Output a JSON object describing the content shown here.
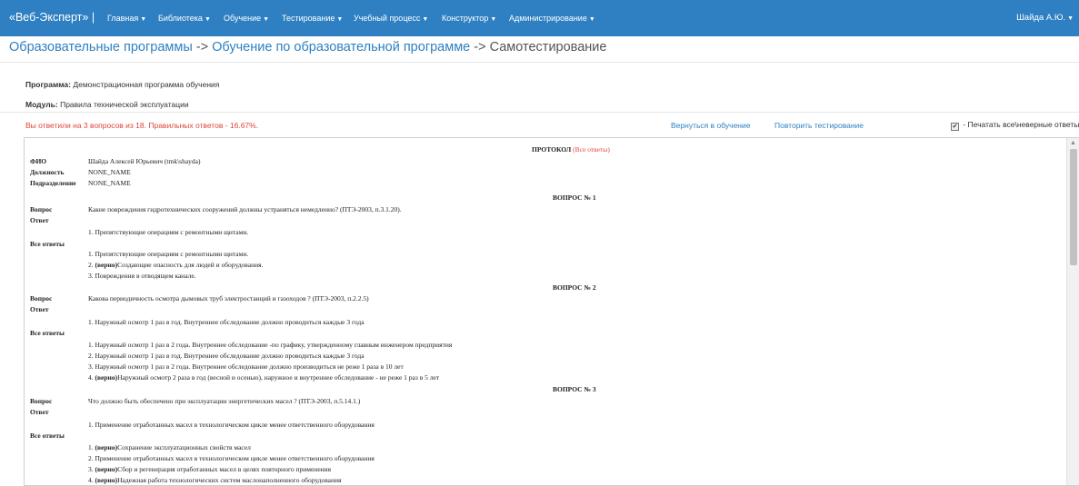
{
  "navbar": {
    "brand": "«Веб-Эксперт» |",
    "menu": [
      "Главная",
      "Библиотека",
      "Обучение",
      "Тестирование",
      "Учебный процесс",
      "Конструктор",
      "Администрирование"
    ],
    "user": "Шайда А.Ю.",
    "colors": {
      "background": "#2f80c2",
      "text": "#ffffff"
    }
  },
  "breadcrumb": {
    "part1": "Образовательные программы",
    "sep1": " -> ",
    "part2": "Обучение по образовательной программе",
    "sep2": " -> ",
    "part3": "Самотестирование"
  },
  "program": {
    "label": "Программа:",
    "value": " Демонстрационная программа обучения"
  },
  "module": {
    "label": "Модуль:",
    "value": " Правила технической эксплуатации"
  },
  "result_text": "Вы ответили на 3 вопросов из 18. Правильных ответов - 16.67%.",
  "actions": {
    "back": "Вернуться в обучение",
    "retry": "Повторить тестирование"
  },
  "print_option": {
    "checked": true,
    "label": " - Печатать все\\неверные ответы"
  },
  "protocol": {
    "title": "ПРОТОКОЛ",
    "all_answers_link": "(Все ответы)",
    "fio_label": "ФИО",
    "fio_value": "Шайда Алексей Юрьевич (tmk\\shayda)",
    "position_label": "Должность",
    "position_value": "NONE_NAME",
    "department_label": "Подразделение",
    "department_value": "NONE_NAME",
    "question_label": "Вопрос",
    "answer_label": "Ответ",
    "all_label": "Все ответы",
    "correct_mark": "(верно)",
    "questions": [
      {
        "header": "ВОПРОС № 1",
        "text": "Какие повреждения гидротехнических сооружений должны устраняться немедленно? (ПТЭ-2003, п.3.1.20).",
        "answer": "1. Препятствующие операциям с ремонтными щитами.",
        "options": [
          {
            "prefix": "1. ",
            "correct": false,
            "text": "Препятствующие операциям с ремонтными щитами."
          },
          {
            "prefix": "2. ",
            "correct": true,
            "text": "Создающие опасность для людей и оборудования."
          },
          {
            "prefix": "3. ",
            "correct": false,
            "text": "Повреждения в отводящем канале."
          }
        ]
      },
      {
        "header": "ВОПРОС № 2",
        "text": "Какова периодичность осмотра дымовых труб электростанций и газоходов ? (ПТЭ-2003, п.2.2.5)",
        "answer": "1. Наружный осмотр 1 раз в год. Внутреннее обследование должно проводиться каждые 3 года",
        "options": [
          {
            "prefix": "1. ",
            "correct": false,
            "text": "Наружный осмотр 1 раз в 2 года. Внутреннее обследование -по графику, утвержденному главным инженером предприятия"
          },
          {
            "prefix": "2. ",
            "correct": false,
            "text": "Наружный осмотр 1 раз в год. Внутреннее обследование должно проводиться каждые 3 года"
          },
          {
            "prefix": "3. ",
            "correct": false,
            "text": "Наружный осмотр 1 раз в 2 года. Внутреннее обследование должно производиться не реже 1 раза в 10 лет"
          },
          {
            "prefix": "4. ",
            "correct": true,
            "text": "Наружный осмотр 2 раза в год (весной и осенью), наружное и внутреннее обследование - не реже 1 раз в 5 лет"
          }
        ]
      },
      {
        "header": "ВОПРОС № 3",
        "text": "Что должно быть обеспечено при эксплуатации энергетических масел ? (ПТЭ-2003, п.5.14.1.)",
        "answer": "1. Применение отработанных масел в технологическом цикле менее ответственного оборудования",
        "options": [
          {
            "prefix": "1. ",
            "correct": true,
            "text": "Сохранение эксплуатационных свойств масел"
          },
          {
            "prefix": "2. ",
            "correct": false,
            "text": "Применение отработанных масел в технологическом цикле менее ответственного оборудования"
          },
          {
            "prefix": "3. ",
            "correct": true,
            "text": "Сбор и регенерация отработанных масел в целях повторного применения"
          },
          {
            "prefix": "4. ",
            "correct": true,
            "text": "Надежная работа технологических систем маслонаполненного оборудования"
          }
        ]
      }
    ]
  }
}
